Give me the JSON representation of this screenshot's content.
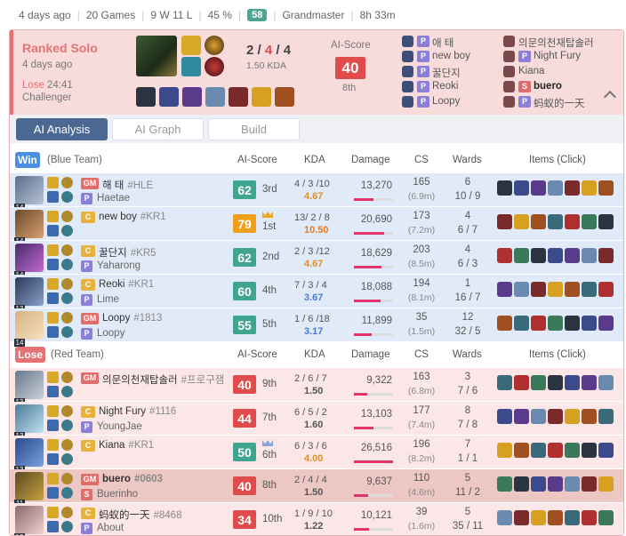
{
  "topbar": {
    "time_ago": "4 days ago",
    "games": "20 Games",
    "record": "9 W 11 L",
    "winrate": "45 %",
    "lp": "58",
    "tier": "Grandmaster",
    "duration": "8h 33m"
  },
  "summary": {
    "queue": "Ranked Solo",
    "time_ago": "4 days ago",
    "result": "Lose",
    "game_length": "24:41",
    "tier": "Challenger",
    "k": "2",
    "d": "4",
    "a": "4",
    "sep1": " / ",
    "sep2": " / ",
    "kda": "1.50 KDA",
    "ai_label": "AI-Score",
    "ai_score": "40",
    "ai_rank": "8th"
  },
  "summary_players": {
    "left": [
      {
        "name": "애 태",
        "badge": "P"
      },
      {
        "name": "new boy",
        "badge": "P"
      },
      {
        "name": "꿀단지",
        "badge": "P"
      },
      {
        "name": "Reoki",
        "badge": "P"
      },
      {
        "name": "Loopy",
        "badge": "P"
      }
    ],
    "right": [
      {
        "name": "의문의천재탑솔러",
        "badge": ""
      },
      {
        "name": "Night Fury",
        "badge": "P"
      },
      {
        "name": "Kiana",
        "badge": ""
      },
      {
        "name": "buero",
        "badge": "S"
      },
      {
        "name": "蚂蚁的一天",
        "badge": "P"
      }
    ]
  },
  "tabs": [
    "AI Analysis",
    "AI Graph",
    "Build"
  ],
  "columns": {
    "ai": "AI-Score",
    "kda": "KDA",
    "damage": "Damage",
    "cs": "CS",
    "wards": "Wards",
    "items": "Items (Click)"
  },
  "blue": {
    "tag": "Win",
    "label": "(Blue Team)"
  },
  "red": {
    "tag": "Lose",
    "label": "(Red Team)"
  },
  "colors": {
    "win": "#4a8fe0",
    "lose": "#e57373",
    "gm": "#e06c6c",
    "challenger": "#e8b23a",
    "score_teal": "#3fa58f",
    "score_red": "#e04c4c",
    "score_gold": "#ef9f1a"
  },
  "blue_players": [
    {
      "level": "14",
      "tier": "GM",
      "name": "해 태",
      "tag": "#HLE",
      "sub": "Haetae",
      "sub_badge": "P",
      "score": "62",
      "rank": "3rd",
      "kda": "4 / 3 /10",
      "ratio": "4.67",
      "damage": "13,270",
      "dmg_frac": 0.5,
      "cs": "165",
      "cspm": "(6.9m)",
      "wards": "6",
      "wards2": "10 / 9",
      "crown": ""
    },
    {
      "level": "14",
      "tier": "C",
      "name": "new boy",
      "tag": "#KR1",
      "sub": "",
      "sub_badge": "",
      "score": "79",
      "rank": "1st",
      "kda": "13/ 2 / 8",
      "ratio": "10.50",
      "damage": "20,690",
      "dmg_frac": 0.78,
      "cs": "173",
      "cspm": "(7.2m)",
      "wards": "4",
      "wards2": "6 / 7",
      "crown": "gold"
    },
    {
      "level": "14",
      "tier": "C",
      "name": "꿀단지",
      "tag": "#KR5",
      "sub": "Yaharong",
      "sub_badge": "P",
      "score": "62",
      "rank": "2nd",
      "kda": "2 / 3 /12",
      "ratio": "4.67",
      "damage": "18,629",
      "dmg_frac": 0.7,
      "cs": "203",
      "cspm": "(8.5m)",
      "wards": "4",
      "wards2": "6 / 3",
      "crown": ""
    },
    {
      "level": "13",
      "tier": "C",
      "name": "Reoki",
      "tag": "#KR1",
      "sub": "Lime",
      "sub_badge": "P",
      "score": "60",
      "rank": "4th",
      "kda": "7 / 3 / 4",
      "ratio": "3.67",
      "damage": "18,088",
      "dmg_frac": 0.68,
      "cs": "194",
      "cspm": "(8.1m)",
      "wards": "1",
      "wards2": "16 / 7",
      "crown": ""
    },
    {
      "level": "14",
      "tier": "GM",
      "name": "Loopy",
      "tag": "#1813",
      "sub": "Loopy",
      "sub_badge": "P",
      "score": "55",
      "rank": "5th",
      "kda": "1 / 6 /18",
      "ratio": "3.17",
      "damage": "11,899",
      "dmg_frac": 0.45,
      "cs": "35",
      "cspm": "(1.5m)",
      "wards": "12",
      "wards2": "32 / 5",
      "crown": ""
    }
  ],
  "red_players": [
    {
      "level": "13",
      "tier": "GM",
      "name": "의문의천재탑솔러",
      "tag": "#프로구잼",
      "sub": "",
      "sub_badge": "",
      "score": "40",
      "rank": "9th",
      "kda": "2 / 6 / 7",
      "ratio": "1.50",
      "damage": "9,322",
      "dmg_frac": 0.35,
      "cs": "163",
      "cspm": "(6.8m)",
      "wards": "3",
      "wards2": "7 / 6",
      "crown": ""
    },
    {
      "level": "13",
      "tier": "C",
      "name": "Night Fury",
      "tag": "#1116",
      "sub": "YoungJae",
      "sub_badge": "P",
      "score": "44",
      "rank": "7th",
      "kda": "6 / 5 / 2",
      "ratio": "1.60",
      "damage": "13,103",
      "dmg_frac": 0.49,
      "cs": "177",
      "cspm": "(7.4m)",
      "wards": "8",
      "wards2": "7 / 8",
      "crown": ""
    },
    {
      "level": "13",
      "tier": "C",
      "name": "Kiana",
      "tag": "#KR1",
      "sub": "",
      "sub_badge": "",
      "score": "50",
      "rank": "6th",
      "kda": "6 / 3 / 6",
      "ratio": "4.00",
      "damage": "26,516",
      "dmg_frac": 1.0,
      "cs": "196",
      "cspm": "(8.2m)",
      "wards": "7",
      "wards2": "1 / 1",
      "crown": "silver"
    },
    {
      "level": "11",
      "tier": "GM",
      "name": "buero",
      "tag": "#0603",
      "sub": "Buerinho",
      "sub_badge": "S",
      "score": "40",
      "rank": "8th",
      "kda": "2 / 4 / 4",
      "ratio": "1.50",
      "damage": "9,637",
      "dmg_frac": 0.36,
      "cs": "110",
      "cspm": "(4.6m)",
      "wards": "5",
      "wards2": "11 / 2",
      "crown": ""
    },
    {
      "level": "10",
      "tier": "C",
      "name": "蚂蚁的一天",
      "tag": "#8468",
      "sub": "About",
      "sub_badge": "P",
      "score": "34",
      "rank": "10th",
      "kda": "1 / 9 / 10",
      "ratio": "1.22",
      "damage": "10,121",
      "dmg_frac": 0.38,
      "cs": "39",
      "cspm": "(1.6m)",
      "wards": "5",
      "wards2": "35 / 11",
      "crown": ""
    }
  ]
}
